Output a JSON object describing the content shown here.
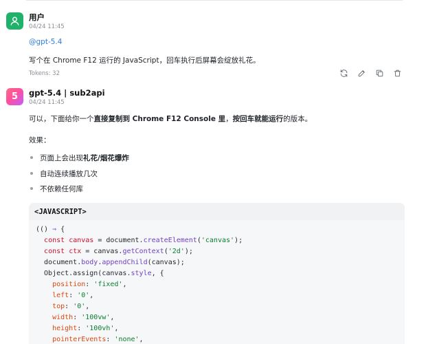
{
  "user_message": {
    "name": "用户",
    "time": "04/24 11:45",
    "mention": "@gpt-5.4",
    "text": "写个在 Chrome F12 运行的 JavaScript，回车执行后屏幕会绽放礼花。",
    "tokens": "Tokens: 32"
  },
  "bot_message": {
    "avatar_char": "5",
    "name": "gpt-5.4 | sub2api",
    "time": "04/24 11:45",
    "intro_prefix": "可以，下面给你一个",
    "intro_bold1": "直接复制到 Chrome F12 Console 里",
    "intro_mid": "，",
    "intro_bold2": "按回车就能运行",
    "intro_suffix": "的版本。",
    "effect_label": "效果：",
    "bullet1_prefix": "页面上会出现",
    "bullet1_bold": "礼花/烟花爆炸",
    "bullet2": "自动连续播放几次",
    "bullet3": "不依赖任何库"
  },
  "actions": {
    "icons": [
      "refresh-icon",
      "edit-icon",
      "copy-icon",
      "delete-icon"
    ]
  },
  "code": {
    "language_label": "<JAVASCRIPT>",
    "lines": [
      "(() ⇒ {",
      "  const canvas = document.createElement('canvas');",
      "  const ctx = canvas.getContext('2d');",
      "  document.body.appendChild(canvas);",
      "  Object.assign(canvas.style, {",
      "    position: 'fixed',",
      "    left: '0',",
      "    top: '0',",
      "    width: '100vw',",
      "    height: '100vh',",
      "    pointerEvents: 'none',"
    ]
  }
}
